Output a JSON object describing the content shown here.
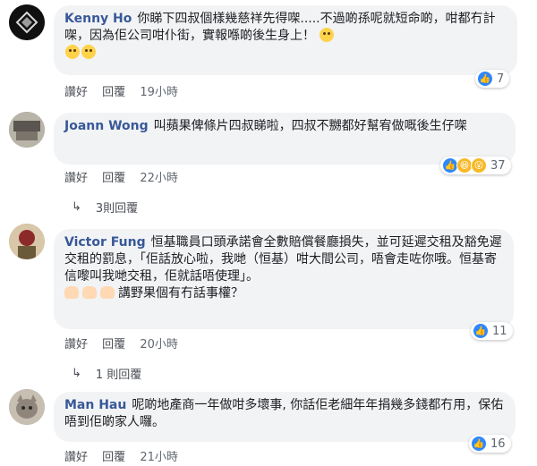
{
  "comments": [
    {
      "author": "Kenny Ho",
      "text": "你睇下四叔個樣幾慈祥先得㗎.....不過啲孫呢就短命啲，咁都冇計㗎，因為佢公司咁仆街，實報喺啲後生身上！",
      "like": "讚好",
      "reply": "回覆",
      "time": "19小時",
      "reaction_count": "7",
      "reactions": [
        "like"
      ]
    },
    {
      "author": "Joann Wong",
      "text": "叫蘋果俾條片四叔睇啦，四叔不嬲都好幫宥做嘅後生仔㗎",
      "like": "讚好",
      "reply": "回覆",
      "time": "22小時",
      "reaction_count": "37",
      "reactions": [
        "like",
        "haha",
        "wow"
      ],
      "replies_link": "3則回覆"
    },
    {
      "author": "Victor Fung",
      "text": "恒基職員口頭承諾會全數賠償餐廳損失，並可延遲交租及豁免遲交租的罰息，「佢話放心啦，我哋（恒基）咁大間公司，唔會走咗你哦。恒基寄信嚟叫我哋交租，佢就話唔使理」。",
      "text2": "講野果個有冇話事權？",
      "like": "讚好",
      "reply": "回覆",
      "time": "20小時",
      "reaction_count": "11",
      "reactions": [
        "like"
      ],
      "replies_link": "1 則回覆"
    },
    {
      "author": "Man Hau",
      "text": "呢啲地產商一年做咁多壞事, 你話佢老細年年捐幾多錢都冇用，保佑唔到佢啲家人囉。",
      "like": "讚好",
      "reply": "回覆",
      "time": "21小時",
      "reaction_count": "16",
      "reactions": [
        "like"
      ]
    }
  ],
  "icons": {
    "like": "thumbs-up-icon",
    "haha": "haha-icon",
    "wow": "wow-icon",
    "reply_arrow": "reply-arrow-icon",
    "emoji": "sad-face-icon",
    "hand": "pointing-hand-icon"
  },
  "colors": {
    "author": "#385898",
    "bubble": "#f2f3f5",
    "like": "#2d88ff"
  }
}
